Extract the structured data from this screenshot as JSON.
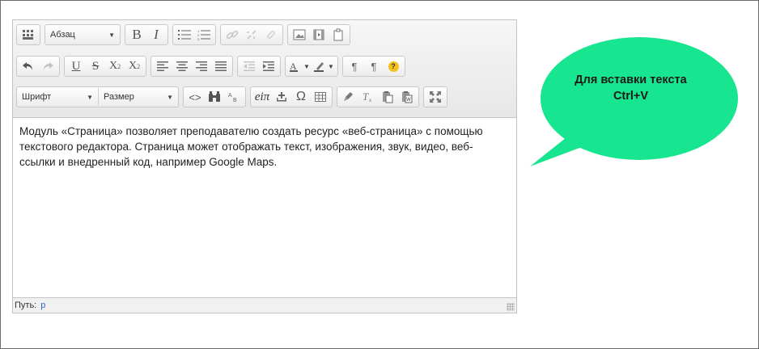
{
  "toolbar": {
    "paragraph_select": "Абзац",
    "font_select": "Шрифт",
    "size_select": "Размер",
    "bold_label": "B",
    "italic_label": "I",
    "underline_label": "U",
    "strike_label": "S",
    "subscript_base": "X",
    "subscript_mark": "2",
    "superscript_base": "X",
    "superscript_mark": "2",
    "omega_label": "Ω",
    "equation_label": "eiπ",
    "help_label": "?"
  },
  "content": {
    "text": "Модуль «Страница» позволяет преподавателю создать ресурс «веб-страница» с помощью текстового редактора. Страница может отображать текст, изображения, звук, видео, веб-ссылки и внедренный код, например Google Maps."
  },
  "statusbar": {
    "path_label": "Путь:",
    "path_value": "p"
  },
  "callout": {
    "line1": "Для вставки текста",
    "line2": "Ctrl+V",
    "color": "#18e58f"
  }
}
